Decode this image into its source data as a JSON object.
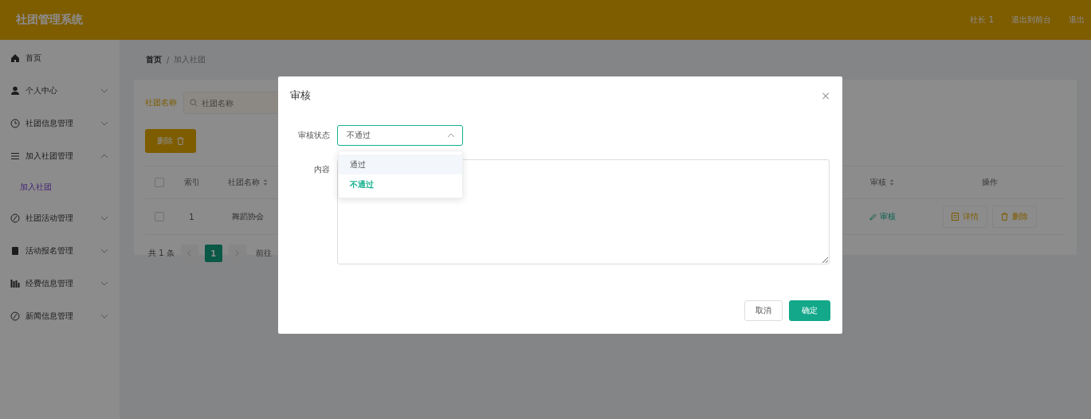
{
  "header": {
    "title": "社团管理系统",
    "links": [
      "社长 1",
      "退出到前台",
      "退出"
    ]
  },
  "sidebar": {
    "items": [
      {
        "label": "首页",
        "kind": "link"
      },
      {
        "label": "个人中心",
        "kind": "group",
        "expanded": false
      },
      {
        "label": "社团信息管理",
        "kind": "group",
        "expanded": false
      },
      {
        "label": "加入社团管理",
        "kind": "group",
        "expanded": true,
        "children": [
          {
            "label": "加入社团",
            "selected": true
          }
        ]
      },
      {
        "label": "社团活动管理",
        "kind": "group",
        "expanded": false
      },
      {
        "label": "活动报名管理",
        "kind": "group",
        "expanded": false
      },
      {
        "label": "经费信息管理",
        "kind": "group",
        "expanded": false
      },
      {
        "label": "新闻信息管理",
        "kind": "group",
        "expanded": false
      }
    ]
  },
  "breadcrumb": {
    "items": [
      "首页",
      "加入社团"
    ],
    "separator": "/"
  },
  "search": {
    "label": "社团名称",
    "placeholder": "社团名称"
  },
  "delete_button": "删除",
  "table": {
    "select_all_checked": false,
    "columns": [
      {
        "label": "索引"
      },
      {
        "label": "社团名称",
        "sortable": true
      },
      {
        "label": "审核",
        "sortable": true
      },
      {
        "label": "操作"
      }
    ],
    "rows": [
      {
        "checked": false,
        "index": "1",
        "name": "舞蹈协会",
        "review": "审核",
        "actions": [
          "详情",
          "删除"
        ]
      }
    ]
  },
  "pagination": {
    "total": "共 1 条",
    "pages": [
      {
        "label": "1",
        "selected": true
      }
    ],
    "goto": "前往"
  },
  "dialog": {
    "title": "审核",
    "close": "×",
    "fields": [
      {
        "kind": "select",
        "label": "审核状态",
        "value": "不通过",
        "open": true,
        "options": [
          {
            "label": "通过",
            "selected": false,
            "hovered": true
          },
          {
            "label": "不通过",
            "selected": true,
            "hovered": false
          }
        ]
      },
      {
        "kind": "textarea",
        "label": "内容"
      }
    ],
    "buttons": [
      {
        "label": "取消",
        "primary": false
      },
      {
        "label": "确定",
        "primary": true
      }
    ]
  }
}
